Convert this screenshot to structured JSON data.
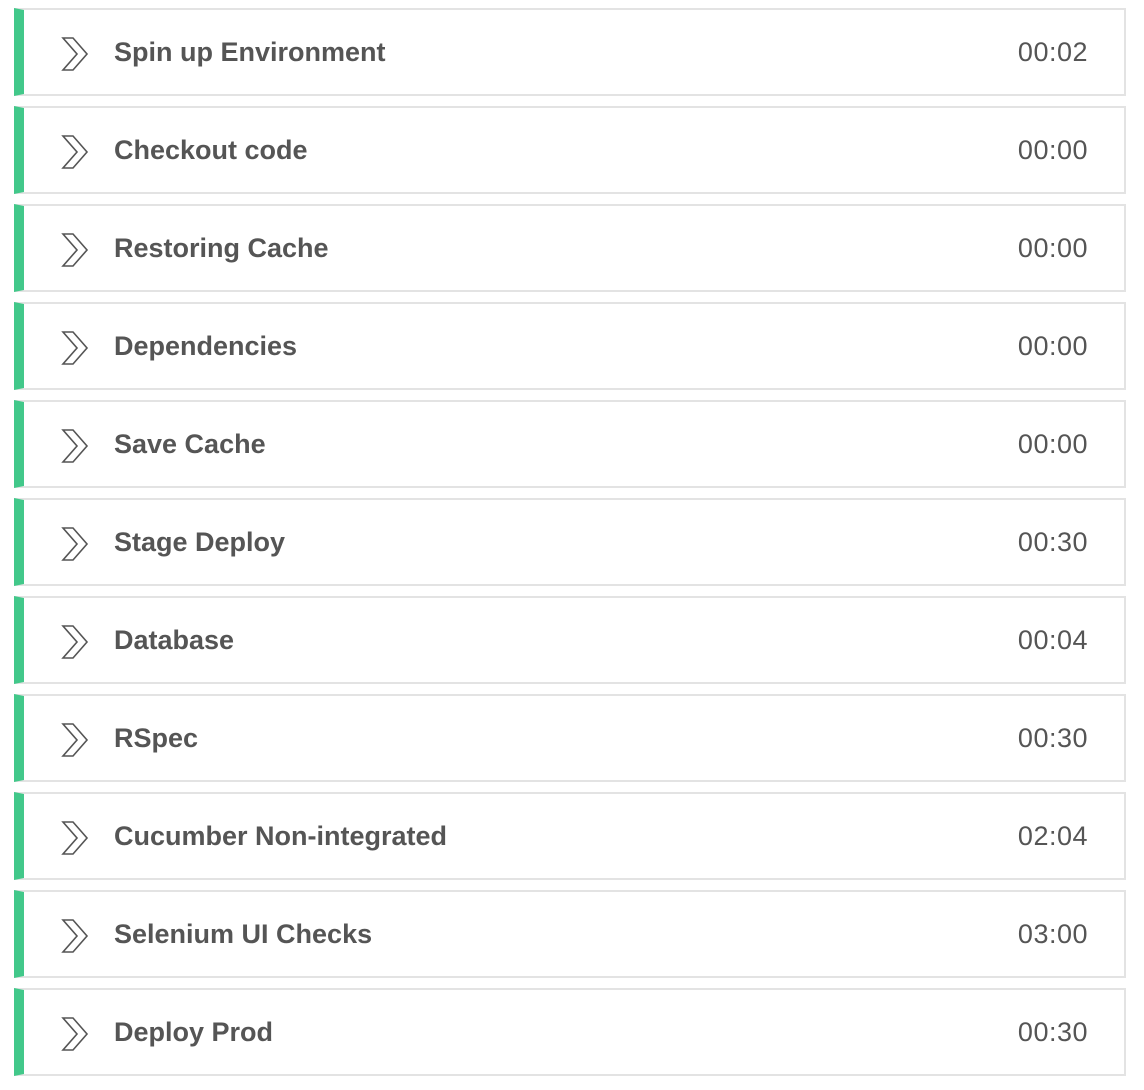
{
  "steps": [
    {
      "name": "Spin up Environment",
      "duration": "00:02",
      "status": "success"
    },
    {
      "name": "Checkout code",
      "duration": "00:00",
      "status": "success"
    },
    {
      "name": "Restoring Cache",
      "duration": "00:00",
      "status": "success"
    },
    {
      "name": "Dependencies",
      "duration": "00:00",
      "status": "success"
    },
    {
      "name": "Save Cache",
      "duration": "00:00",
      "status": "success"
    },
    {
      "name": "Stage Deploy",
      "duration": "00:30",
      "status": "success"
    },
    {
      "name": "Database",
      "duration": "00:04",
      "status": "success"
    },
    {
      "name": "RSpec",
      "duration": "00:30",
      "status": "success"
    },
    {
      "name": "Cucumber Non-integrated",
      "duration": "02:04",
      "status": "success"
    },
    {
      "name": "Selenium UI Checks",
      "duration": "03:00",
      "status": "success"
    },
    {
      "name": "Deploy Prod",
      "duration": "00:30",
      "status": "success"
    }
  ],
  "icons": {
    "expand": "chevron-right-icon"
  },
  "colors": {
    "success": "#42c88a",
    "text": "#555555",
    "border": "#e3e3e3"
  }
}
